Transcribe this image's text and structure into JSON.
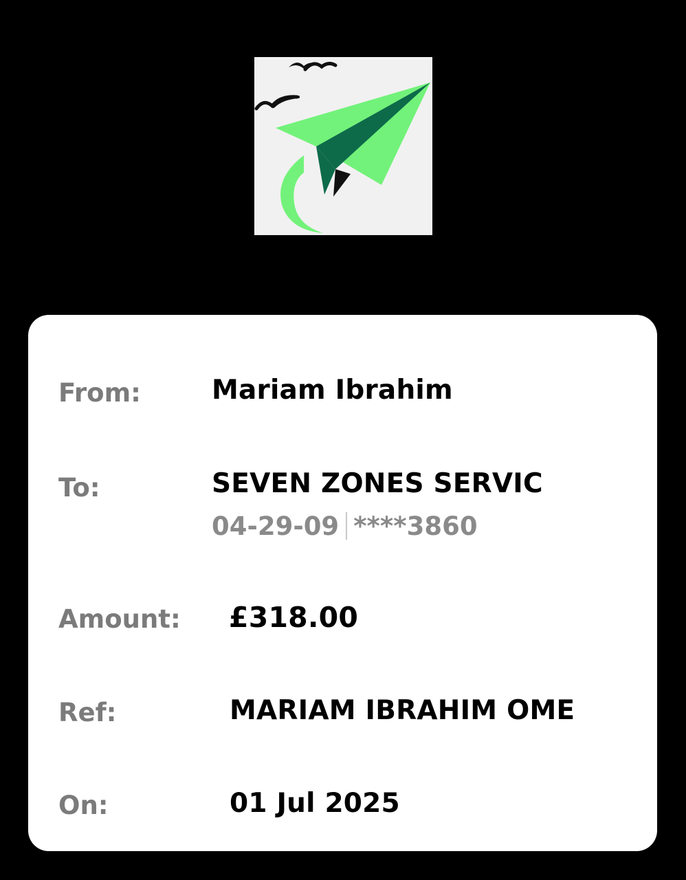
{
  "colors": {
    "background": "#000000",
    "card": "#ffffff",
    "label": "#7b7b7b",
    "value": "#000000",
    "account_detail": "#8a8a8a",
    "logo_light_green": "#72f27a",
    "logo_dark_green": "#0d6b4a"
  },
  "logo": {
    "icon": "paper-plane-with-birds-logo"
  },
  "transfer": {
    "from": {
      "label": "From:",
      "value": "Mariam Ibrahim"
    },
    "to": {
      "label": "To:",
      "value": "SEVEN ZONES SERVIC",
      "sort_code": "04-29-09",
      "account_number": "****3860"
    },
    "amount": {
      "label": "Amount:",
      "value": "£318.00"
    },
    "ref": {
      "label": "Ref:",
      "value": "MARIAM IBRAHIM OME"
    },
    "on": {
      "label": "On:",
      "value": "01 Jul 2025"
    }
  }
}
